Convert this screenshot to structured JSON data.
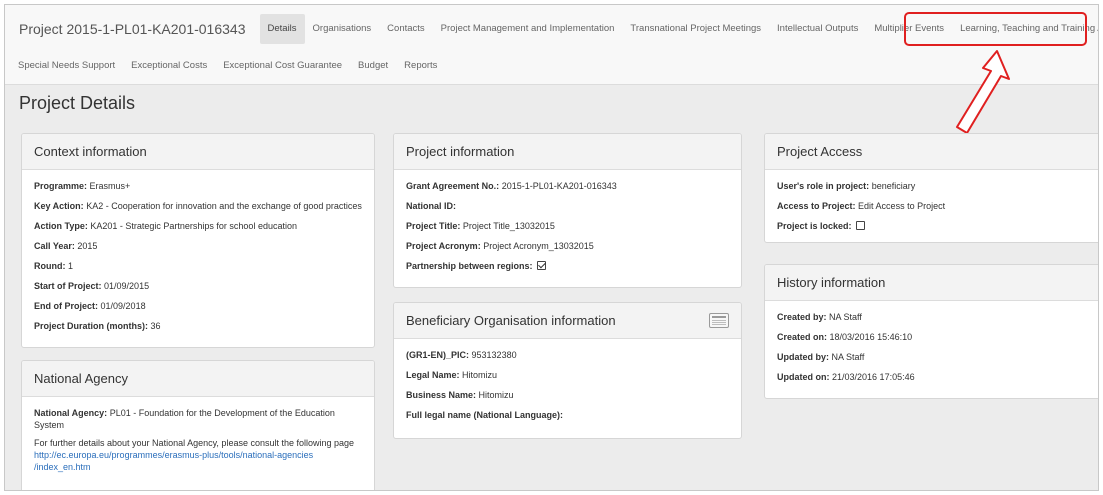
{
  "nav": {
    "brand": "Project 2015-1-PL01-KA201-016343",
    "tabs_row1": [
      "Details",
      "Organisations",
      "Contacts",
      "Project Management and Implementation",
      "Transnational Project Meetings",
      "Intellectual Outputs",
      "Multiplier Events",
      "Learning, Teaching and Training Activities"
    ],
    "tabs_row2": [
      "Special Needs Support",
      "Exceptional Costs",
      "Exceptional Cost Guarantee",
      "Budget",
      "Reports"
    ],
    "active_tab": "Details"
  },
  "page_title": "Project Details",
  "context": {
    "title": "Context information",
    "fields": [
      {
        "label": "Programme:",
        "value": "Erasmus+"
      },
      {
        "label": "Key Action:",
        "value": "KA2 - Cooperation for innovation and the exchange of good practices"
      },
      {
        "label": "Action Type:",
        "value": "KA201 - Strategic Partnerships for school education"
      },
      {
        "label": "Call Year:",
        "value": "2015"
      },
      {
        "label": "Round:",
        "value": "1"
      },
      {
        "label": "Start of Project:",
        "value": "01/09/2015"
      },
      {
        "label": "End of Project:",
        "value": "01/09/2018"
      },
      {
        "label": "Project Duration (months):",
        "value": "36"
      }
    ]
  },
  "agency": {
    "title": "National Agency",
    "label": "National Agency:",
    "value": "PL01 - Foundation for the Development of the Education System",
    "note": "For further details about your National Agency, please consult the following page",
    "link_line1": "http://ec.europa.eu/programmes/erasmus-plus/tools/national-agencies",
    "link_line2": "/index_en.htm"
  },
  "project": {
    "title": "Project information",
    "fields": [
      {
        "label": "Grant Agreement No.:",
        "value": "2015-1-PL01-KA201-016343"
      },
      {
        "label": "National ID:",
        "value": ""
      },
      {
        "label": "Project Title:",
        "value": "Project Title_13032015"
      },
      {
        "label": "Project Acronym:",
        "value": "Project Acronym_13032015"
      }
    ],
    "partnership_label": "Partnership between regions:",
    "partnership_checked": true
  },
  "beneficiary": {
    "title": "Beneficiary Organisation information",
    "icon": "card-icon",
    "fields": [
      {
        "label": "(GR1-EN)_PIC:",
        "value": "953132380"
      },
      {
        "label": "Legal Name:",
        "value": "Hitomizu"
      },
      {
        "label": "Business Name:",
        "value": "Hitomizu"
      },
      {
        "label": "Full legal name (National Language):",
        "value": ""
      }
    ]
  },
  "access": {
    "title": "Project Access",
    "fields": [
      {
        "label": "User's role in project:",
        "value": "beneficiary"
      },
      {
        "label": "Access to Project:",
        "value": "Edit Access to Project"
      }
    ],
    "locked_label": "Project is locked:",
    "locked_checked": false
  },
  "history": {
    "title": "History information",
    "fields": [
      {
        "label": "Created by:",
        "value": "NA Staff"
      },
      {
        "label": "Created on:",
        "value": "18/03/2016 15:46:10"
      },
      {
        "label": "Updated by:",
        "value": "NA Staff"
      },
      {
        "label": "Updated on:",
        "value": "21/03/2016 17:05:46"
      }
    ]
  },
  "colors": {
    "highlight": "#e02020",
    "link": "#2a6ebb",
    "background": "#ececec"
  }
}
